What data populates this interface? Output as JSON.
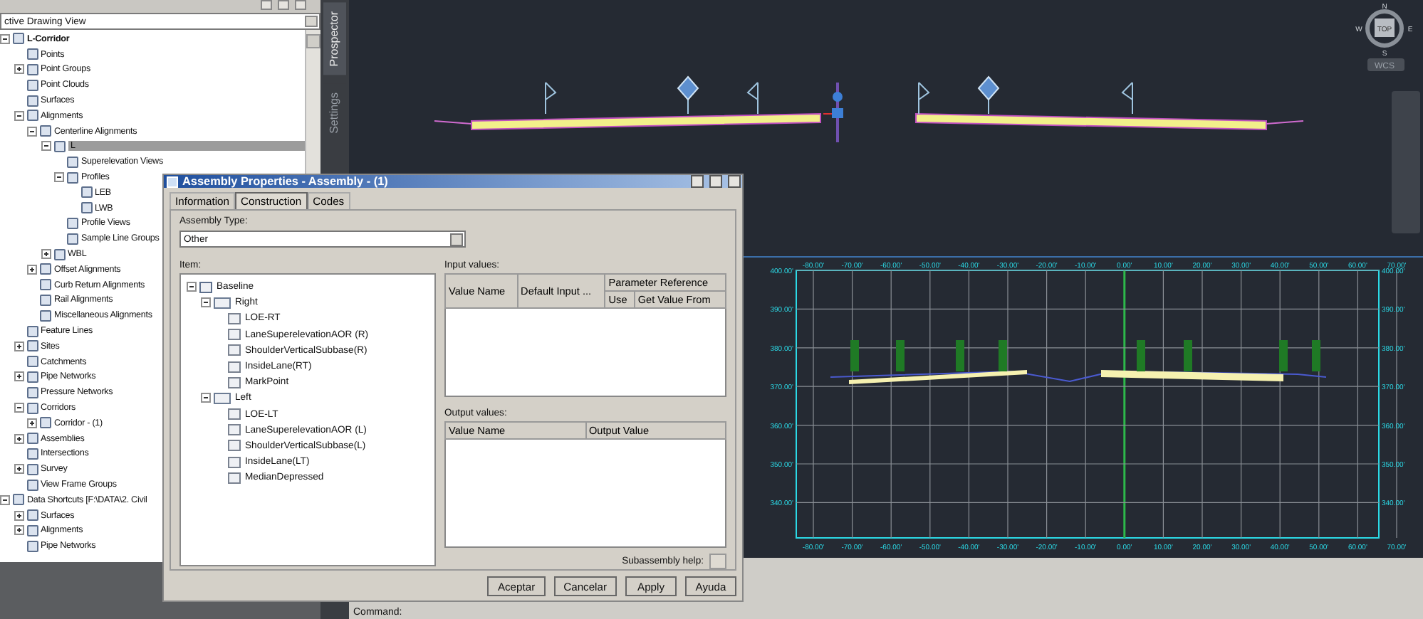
{
  "toolspace": {
    "view_dropdown": "ctive Drawing View",
    "side_tabs": [
      {
        "label": "Prospector",
        "selected": true
      },
      {
        "label": "Settings",
        "selected": false
      }
    ],
    "tree": [
      {
        "label": "L-Corridor",
        "kind": "drawing",
        "selected": false,
        "expanded": true,
        "children": [
          {
            "label": "Points",
            "selected": false
          },
          {
            "label": "Point Groups",
            "selected": false,
            "expanded": false
          },
          {
            "label": "Point Clouds",
            "selected": false
          },
          {
            "label": "Surfaces",
            "selected": false
          },
          {
            "label": "Alignments",
            "selected": false,
            "expanded": true,
            "children": [
              {
                "label": "Centerline Alignments",
                "selected": false,
                "expanded": true,
                "children": [
                  {
                    "label": "L",
                    "selected": true,
                    "expanded": true,
                    "children": [
                      {
                        "label": "Superelevation Views",
                        "selected": false
                      },
                      {
                        "label": "Profiles",
                        "selected": false,
                        "expanded": true,
                        "children": [
                          {
                            "label": "LEB",
                            "selected": false
                          },
                          {
                            "label": "LWB",
                            "selected": false
                          }
                        ]
                      },
                      {
                        "label": "Profile Views",
                        "selected": false
                      },
                      {
                        "label": "Sample Line Groups",
                        "selected": false
                      }
                    ]
                  },
                  {
                    "label": "WBL",
                    "selected": false,
                    "expanded": false
                  }
                ]
              },
              {
                "label": "Offset Alignments",
                "selected": false,
                "expanded": false
              },
              {
                "label": "Curb Return Alignments",
                "selected": false
              },
              {
                "label": "Rail Alignments",
                "selected": false
              },
              {
                "label": "Miscellaneous Alignments",
                "selected": false
              }
            ]
          },
          {
            "label": "Feature Lines",
            "selected": false
          },
          {
            "label": "Sites",
            "selected": false,
            "expanded": false
          },
          {
            "label": "Catchments",
            "selected": false
          },
          {
            "label": "Pipe Networks",
            "selected": false,
            "expanded": false
          },
          {
            "label": "Pressure Networks",
            "selected": false
          },
          {
            "label": "Corridors",
            "selected": false,
            "expanded": true,
            "children": [
              {
                "label": "Corridor - (1)",
                "selected": false,
                "expanded": false
              }
            ]
          },
          {
            "label": "Assemblies",
            "selected": false,
            "expanded": false
          },
          {
            "label": "Intersections",
            "selected": false
          },
          {
            "label": "Survey",
            "selected": false,
            "expanded": false
          },
          {
            "label": "View Frame Groups",
            "selected": false
          }
        ]
      },
      {
        "label": "Data Shortcuts [F:\\DATA\\2. Civil",
        "kind": "shortcuts",
        "selected": false,
        "expanded": true,
        "children": [
          {
            "label": "Surfaces",
            "selected": false,
            "expanded": false
          },
          {
            "label": "Alignments",
            "selected": false,
            "expanded": false
          },
          {
            "label": "Pipe Networks",
            "selected": false
          }
        ]
      }
    ]
  },
  "viewport": {
    "compass": {
      "n": "N",
      "s": "S",
      "e": "E",
      "w": "W",
      "top": "TOP"
    },
    "ucs": "WCS"
  },
  "section_view": {
    "top_labels": [
      "-80.00'",
      "-70.00'",
      "-60.00'",
      "-50.00'",
      "-40.00'",
      "-30.00'",
      "-20.00'",
      "-10.00'",
      "0.00'",
      "10.00'",
      "20.00'",
      "30.00'",
      "40.00'",
      "50.00'",
      "60.00'",
      "70.00'"
    ],
    "bottom_labels": [
      "-80.00'",
      "-70.00'",
      "-60.00'",
      "-50.00'",
      "-40.00'",
      "-30.00'",
      "-20.00'",
      "-10.00'",
      "0.00'",
      "10.00'",
      "20.00'",
      "30.00'",
      "40.00'",
      "50.00'",
      "60.00'",
      "70.00'"
    ],
    "left_labels": [
      "400.00'",
      "390.00'",
      "380.00'",
      "370.00'",
      "360.00'",
      "350.00'",
      "340.00'"
    ],
    "right_labels": [
      "400.00'",
      "390.00'",
      "380.00'",
      "370.00'",
      "360.00'",
      "350.00'",
      "340.00'"
    ]
  },
  "command_line": "Command:",
  "dialog": {
    "title": "Assembly Properties - Assembly - (1)",
    "tabs": [
      {
        "label": "Information",
        "selected": false
      },
      {
        "label": "Construction",
        "selected": true
      },
      {
        "label": "Codes",
        "selected": false
      }
    ],
    "assembly_type_label": "Assembly Type:",
    "assembly_type": "Other",
    "item_label": "Item:",
    "items": [
      {
        "label": "Baseline",
        "kind": "baseline",
        "expanded": true,
        "children": [
          {
            "label": "Right",
            "kind": "group",
            "expanded": true,
            "children": [
              {
                "label": "LOE-RT",
                "kind": "sub"
              },
              {
                "label": "LaneSuperelevationAOR (R)",
                "kind": "sub"
              },
              {
                "label": "ShoulderVerticalSubbase(R)",
                "kind": "sub"
              },
              {
                "label": "InsideLane(RT)",
                "kind": "sub"
              },
              {
                "label": "MarkPoint",
                "kind": "sub"
              }
            ]
          },
          {
            "label": "Left",
            "kind": "group",
            "expanded": true,
            "children": [
              {
                "label": "LOE-LT",
                "kind": "sub"
              },
              {
                "label": "LaneSuperelevationAOR (L)",
                "kind": "sub"
              },
              {
                "label": "ShoulderVerticalSubbase(L)",
                "kind": "sub"
              },
              {
                "label": "InsideLane(LT)",
                "kind": "sub"
              },
              {
                "label": "MedianDepressed",
                "kind": "sub"
              }
            ]
          }
        ]
      }
    ],
    "input_label": "Input values:",
    "input_columns": {
      "value_name": "Value Name",
      "default_input": "Default Input ...",
      "parameter_reference": "Parameter Reference",
      "use": "Use",
      "get_value_from": "Get Value From"
    },
    "output_label": "Output values:",
    "output_columns": [
      "Value Name",
      "Output Value"
    ],
    "help_label": "Subassembly help:",
    "buttons": [
      "Aceptar",
      "Cancelar",
      "Apply",
      "Ayuda"
    ]
  }
}
